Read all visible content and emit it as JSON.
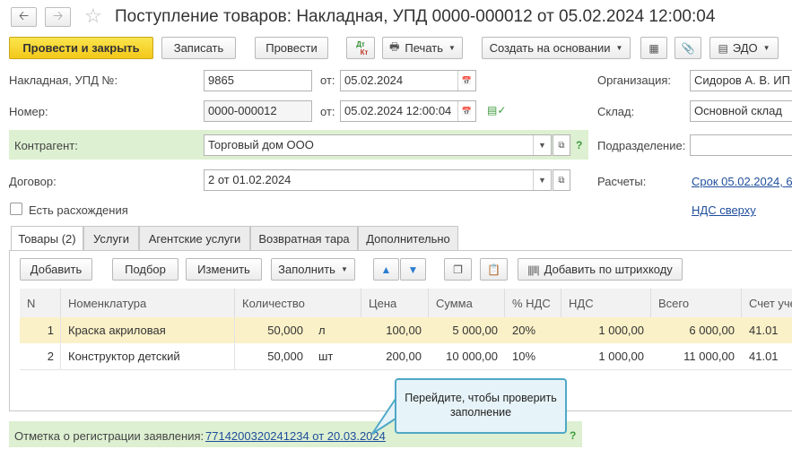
{
  "window": {
    "title": "Поступление товаров: Накладная, УПД 0000-000012 от 05.02.2024 12:00:04",
    "back_icon": "arrow-left-icon",
    "forward_icon": "arrow-right-icon",
    "favorite_icon": "star-icon"
  },
  "toolbar": {
    "post_close": "Провести и закрыть",
    "save": "Записать",
    "post": "Провести",
    "dt_kt_top": "Дт",
    "dt_kt_bottom": "Кт",
    "print": "Печать",
    "create_based": "Создать на основании",
    "edo": "ЭДО"
  },
  "form": {
    "invoice_label": "Накладная, УПД №:",
    "invoice_number": "9865",
    "from_label": "от:",
    "invoice_date": "05.02.2024",
    "number_label": "Номер:",
    "doc_number": "0000-000012",
    "doc_datetime": "05.02.2024 12:00:04",
    "counterparty_label": "Контрагент:",
    "counterparty": "Торговый дом ООО",
    "contract_label": "Договор:",
    "contract": "2 от 01.02.2024",
    "discrepancy_label": "Есть расхождения",
    "org_label": "Организация:",
    "org": "Сидоров А. В. ИП",
    "warehouse_label": "Склад:",
    "warehouse": "Основной склад",
    "department_label": "Подразделение:",
    "department": "",
    "settlements_label": "Расчеты:",
    "settlements_link": "Срок 05.02.2024, 6",
    "vat_link": "НДС сверху",
    "help": "?"
  },
  "tabs": [
    {
      "label": "Товары (2)",
      "active": true
    },
    {
      "label": "Услуги"
    },
    {
      "label": "Агентские услуги"
    },
    {
      "label": "Возвратная тара"
    },
    {
      "label": "Дополнительно"
    }
  ],
  "table_toolbar": {
    "add": "Добавить",
    "select": "Подбор",
    "change": "Изменить",
    "fill": "Заполнить",
    "barcode": "Добавить по штрихкоду"
  },
  "table": {
    "columns": [
      "N",
      "Номенклатура",
      "Количество",
      "Цена",
      "Сумма",
      "% НДС",
      "НДС",
      "Всего",
      "Счет уче"
    ],
    "rows": [
      {
        "n": "1",
        "name": "Краска акриловая",
        "qty": "50,000",
        "unit": "л",
        "price": "100,00",
        "sum": "5 000,00",
        "vat_rate": "20%",
        "vat": "1 000,00",
        "total": "6 000,00",
        "account": "41.01"
      },
      {
        "n": "2",
        "name": "Конструктор детский",
        "qty": "50,000",
        "unit": "шт",
        "price": "200,00",
        "sum": "10 000,00",
        "vat_rate": "10%",
        "vat": "1 000,00",
        "total": "11 000,00",
        "account": "41.01"
      }
    ]
  },
  "footer": {
    "registration_label": "Отметка о регистрации заявления:",
    "registration_link": "7714200320241234 от 20.03.2024",
    "help": "?"
  },
  "tooltip": {
    "line1": "Перейдите, чтобы проверить",
    "line2": "заполнение"
  },
  "colors": {
    "primary_button": "#f3c81a",
    "highlight_green": "#ddf0d2",
    "selected_row": "#fbf1c8",
    "link": "#1f4e9c",
    "tooltip_border": "#4fa8c7"
  }
}
